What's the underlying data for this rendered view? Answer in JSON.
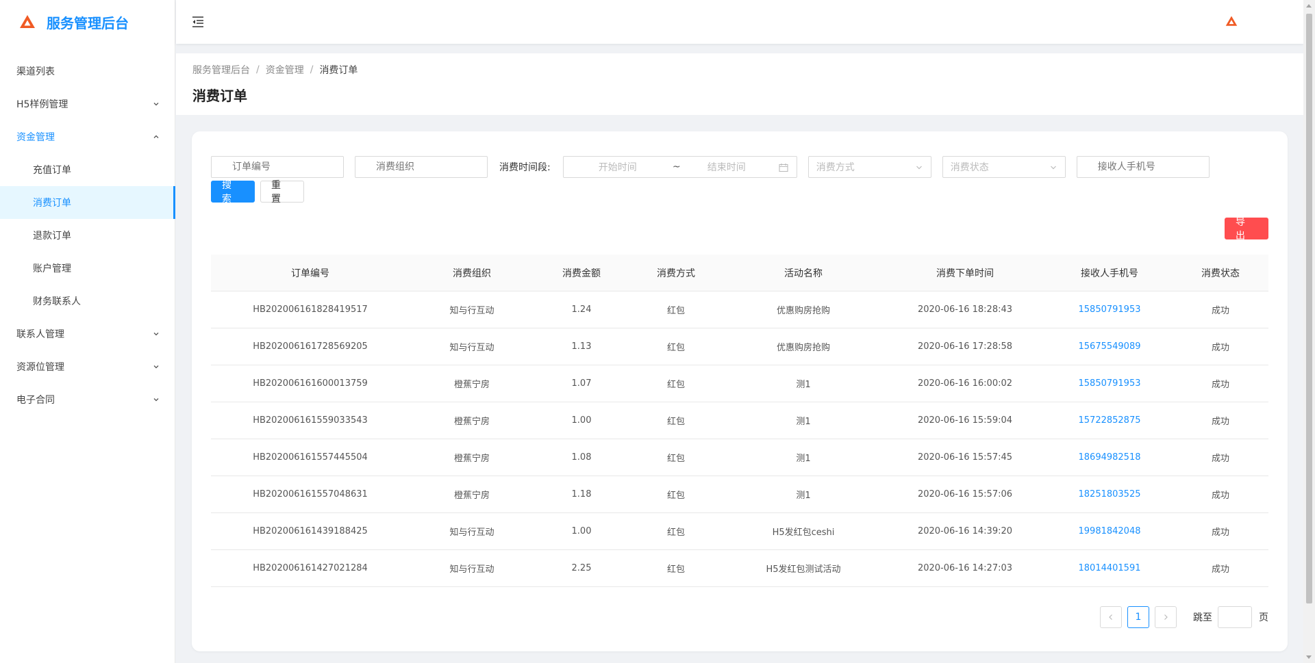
{
  "app": {
    "title": "服务管理后台",
    "brand_color": "#1890ff",
    "logo_color": "#f05a24"
  },
  "sidebar": {
    "items": [
      {
        "label": "渠道列表",
        "level": 1,
        "expandable": false
      },
      {
        "label": "H5样例管理",
        "level": 1,
        "expandable": true,
        "expanded": false
      },
      {
        "label": "资金管理",
        "level": 1,
        "expandable": true,
        "expanded": true
      },
      {
        "label": "充值订单",
        "level": 2
      },
      {
        "label": "消费订单",
        "level": 2,
        "active": true
      },
      {
        "label": "退款订单",
        "level": 2
      },
      {
        "label": "账户管理",
        "level": 2
      },
      {
        "label": "财务联系人",
        "level": 2
      },
      {
        "label": "联系人管理",
        "level": 1,
        "expandable": true,
        "expanded": false
      },
      {
        "label": "资源位管理",
        "level": 1,
        "expandable": true,
        "expanded": false
      },
      {
        "label": "电子合同",
        "level": 1,
        "expandable": true,
        "expanded": false
      }
    ]
  },
  "breadcrumb": [
    "服务管理后台",
    "资金管理",
    "消费订单"
  ],
  "page_title": "消费订单",
  "filters": {
    "order_no_placeholder": "订单编号",
    "org_placeholder": "消费组织",
    "time_label": "消费时间段:",
    "start_placeholder": "开始时间",
    "range_sep": "~",
    "end_placeholder": "结束时间",
    "method_placeholder": "消费方式",
    "status_placeholder": "消费状态",
    "phone_placeholder": "接收人手机号"
  },
  "actions": {
    "search_label": "搜索",
    "reset_label": "重置",
    "export_label": "导出"
  },
  "table": {
    "columns": [
      "订单编号",
      "消费组织",
      "消费金额",
      "消费方式",
      "活动名称",
      "消费下单时间",
      "接收人手机号",
      "消费状态"
    ],
    "rows": [
      [
        "HB202006161828419517",
        "知与行互动",
        "1.24",
        "红包",
        "优惠购房抢购",
        "2020-06-16 18:28:43",
        "15850791953",
        "成功"
      ],
      [
        "HB202006161728569205",
        "知与行互动",
        "1.13",
        "红包",
        "优惠购房抢购",
        "2020-06-16 17:28:58",
        "15675549089",
        "成功"
      ],
      [
        "HB202006161600013759",
        "橙蕉宁房",
        "1.07",
        "红包",
        "测1",
        "2020-06-16 16:00:02",
        "15850791953",
        "成功"
      ],
      [
        "HB202006161559033543",
        "橙蕉宁房",
        "1.00",
        "红包",
        "测1",
        "2020-06-16 15:59:04",
        "15722852875",
        "成功"
      ],
      [
        "HB202006161557445504",
        "橙蕉宁房",
        "1.08",
        "红包",
        "测1",
        "2020-06-16 15:57:45",
        "18694982518",
        "成功"
      ],
      [
        "HB202006161557048631",
        "橙蕉宁房",
        "1.18",
        "红包",
        "测1",
        "2020-06-16 15:57:06",
        "18251803525",
        "成功"
      ],
      [
        "HB202006161439188425",
        "知与行互动",
        "1.00",
        "红包",
        "H5发红包ceshi",
        "2020-06-16 14:39:20",
        "19981842048",
        "成功"
      ],
      [
        "HB202006161427021284",
        "知与行互动",
        "2.25",
        "红包",
        "H5发红包测试活动",
        "2020-06-16 14:27:03",
        "18014401591",
        "成功"
      ]
    ]
  },
  "pagination": {
    "current_page": "1",
    "jump_label": "跳至",
    "jump_suffix": "页"
  }
}
